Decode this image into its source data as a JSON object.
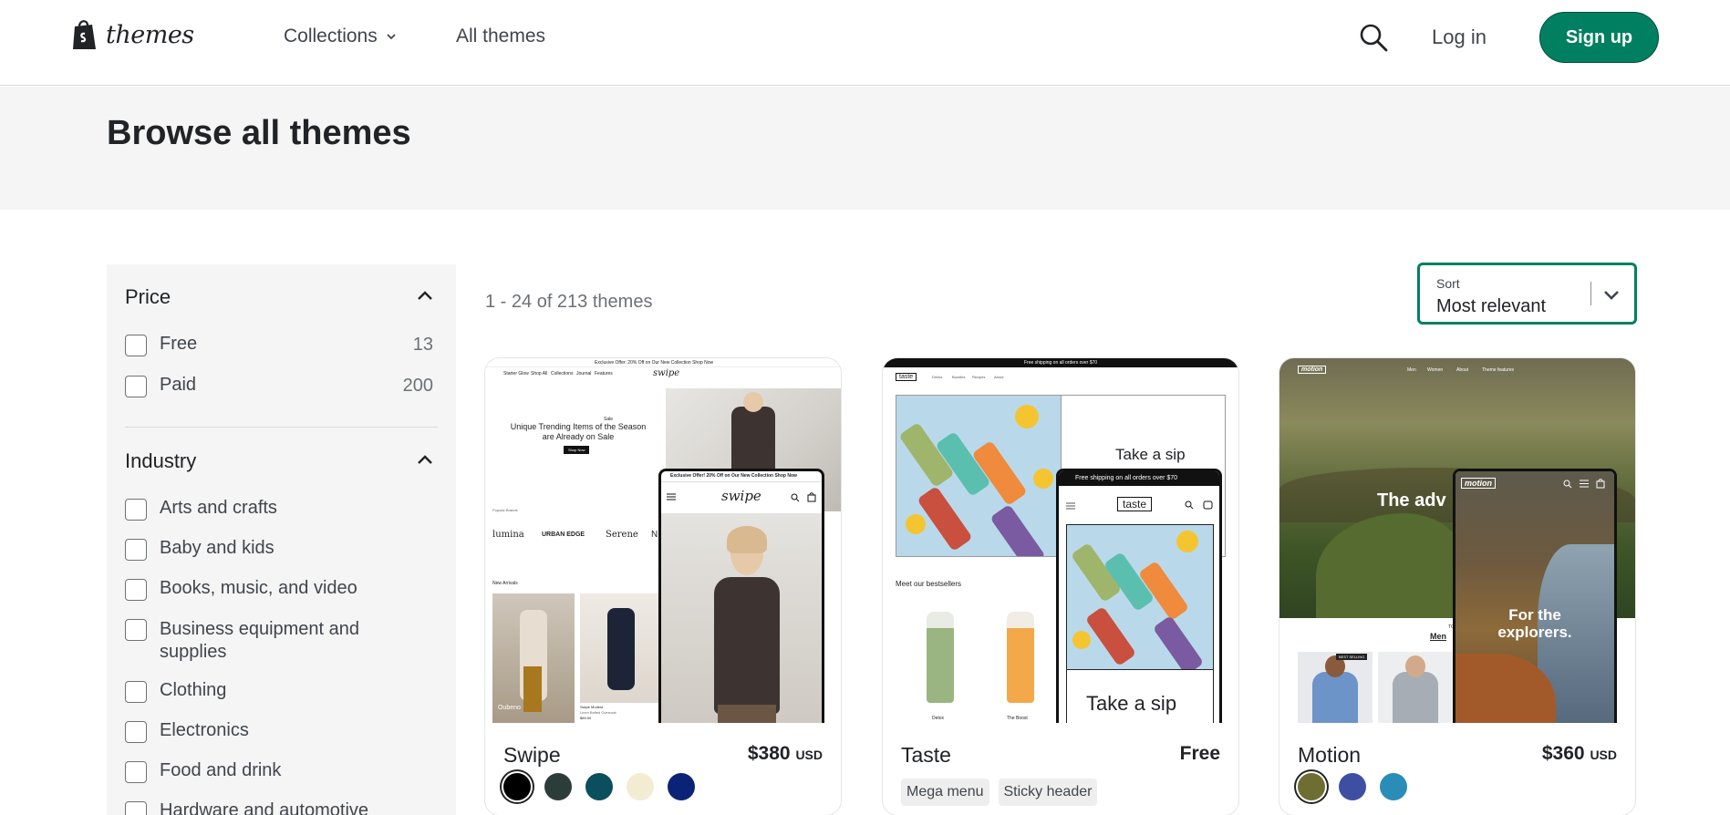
{
  "header": {
    "logo_text": "themes",
    "nav": {
      "collections": "Collections",
      "all_themes": "All themes"
    },
    "login": "Log in",
    "signup": "Sign up"
  },
  "banner": {
    "title": "Browse all themes"
  },
  "sidebar": {
    "price": {
      "title": "Price",
      "options": [
        {
          "label": "Free",
          "count": "13"
        },
        {
          "label": "Paid",
          "count": "200"
        }
      ]
    },
    "industry": {
      "title": "Industry",
      "options": [
        "Arts and crafts",
        "Baby and kids",
        "Books, music, and video",
        "Business equipment and supplies",
        "Clothing",
        "Electronics",
        "Food and drink",
        "Hardware and automotive"
      ]
    }
  },
  "results": {
    "count": "1 - 24 of 213 themes",
    "sort_label": "Sort",
    "sort_value": "Most relevant"
  },
  "cards": [
    {
      "name": "Swipe",
      "price": "$380",
      "currency": "USD",
      "swatches": [
        "#000000",
        "#2c3d39",
        "#0b4f5e",
        "#f2ecd3",
        "#0b2377"
      ],
      "preview": {
        "topbar": "Exclusive Offer: 20% Off on Our New Collection Shop Now",
        "nav_links": [
          "Starter Glow",
          "Shop All",
          "Collections",
          "Journal",
          "Features"
        ],
        "brand": "swipe",
        "hero_small": "Sale",
        "hero_title": "Unique Trending Items of the Season are Already on Sale",
        "hero_btn": "Shop Now",
        "popular": "Popular Brands",
        "brands": [
          "lumina",
          "URBAN EDGE",
          "Serene",
          "N"
        ],
        "new_arrivals": "New Arrivals",
        "prod_label": "Oubeno",
        "prod2_name": "Swipe Modest",
        "prod2_desc": "Linen Belted Overcoat",
        "prod2_price": "$89.00",
        "phone_topbar": "Exclusive Offer! 20% Off on Our New Collection Shop Now"
      }
    },
    {
      "name": "Taste",
      "price": "Free",
      "tags": [
        "Mega menu",
        "Sticky header"
      ],
      "preview": {
        "topbar": "Free shipping on all orders over $70",
        "brand": "taste",
        "nav_links": [
          "Drinks",
          "Bundles",
          "Recipes",
          "About"
        ],
        "headline": "Take a sip",
        "bestsellers": "Meet our bestsellers",
        "prod1": "Detox",
        "prod2": "The Boost",
        "phone_topbar": "Free shipping on all orders over $70",
        "phone_headline": "Take a sip"
      }
    },
    {
      "name": "Motion",
      "price": "$360",
      "currency": "USD",
      "swatches": [
        "#6e6e32",
        "#3e4fa3",
        "#2a8db8"
      ],
      "preview": {
        "brand": "motion",
        "nav_links": [
          "Men",
          "Women",
          "About",
          "Theme features"
        ],
        "hero": "The adv",
        "phone_hero_1": "For the",
        "phone_hero_2": "explorers.",
        "section_top": "TOP",
        "section_link": "Men",
        "badge": "BEST SELLING"
      }
    }
  ],
  "colors": {
    "brand_green": "#008060",
    "banner_bg": "#f5f5f5",
    "text_primary": "#212326",
    "text_secondary": "#6d7175"
  }
}
